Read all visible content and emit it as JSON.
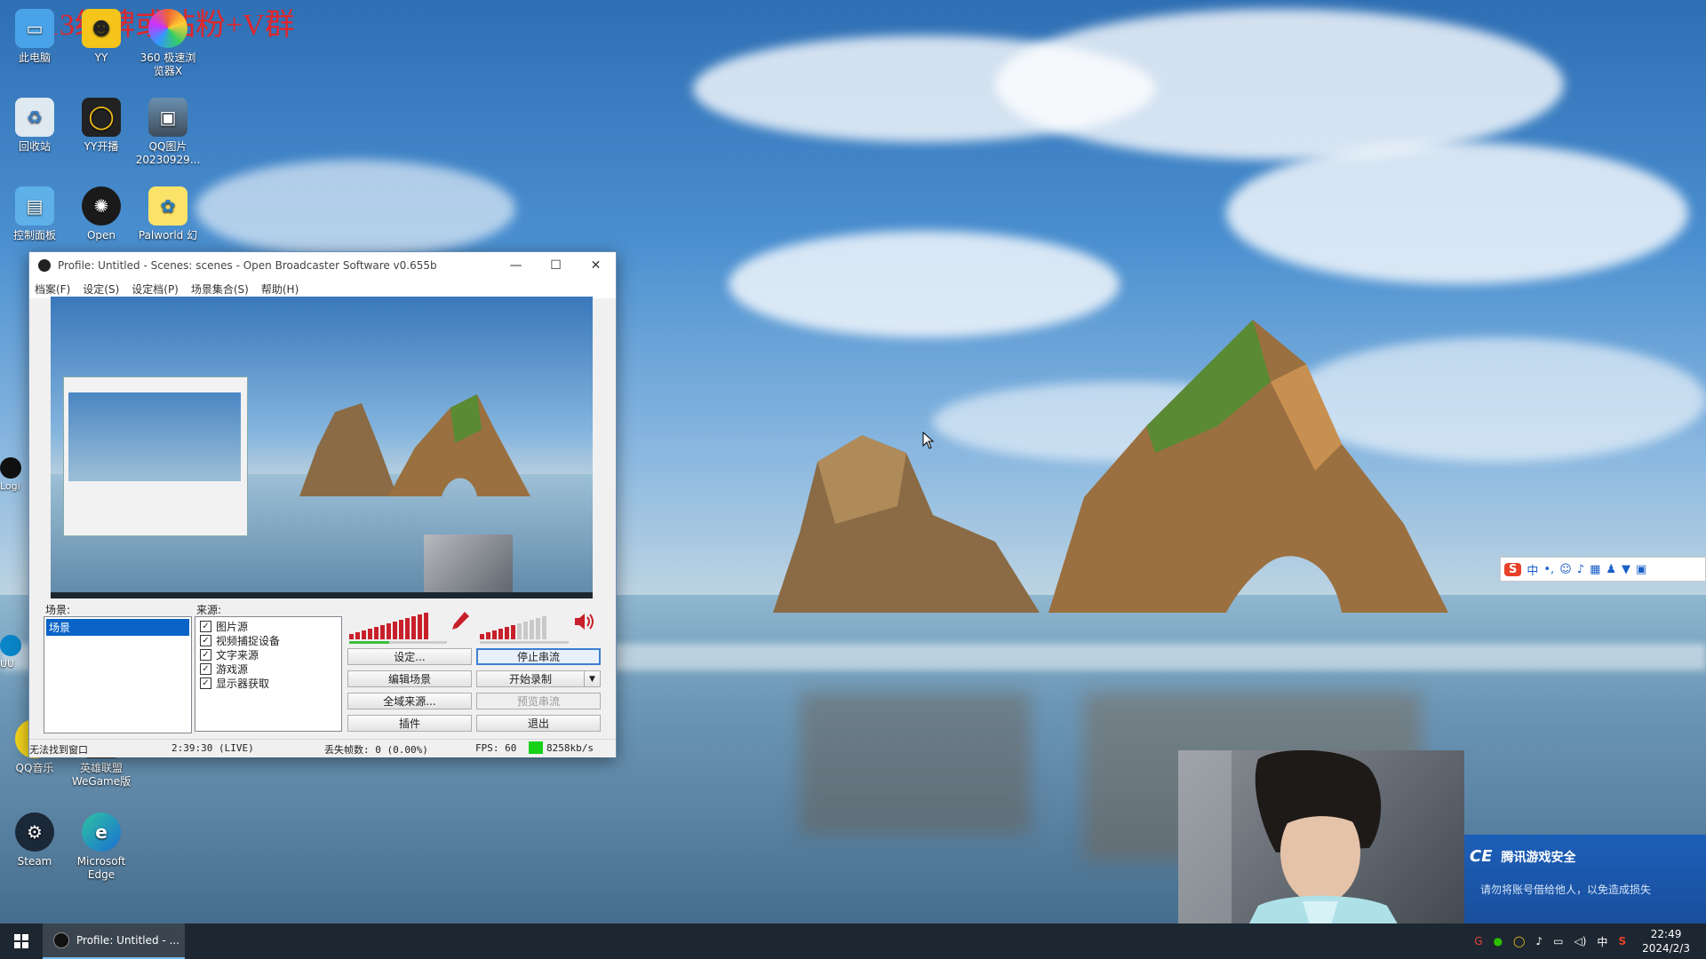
{
  "banner": "13级牌或钻粉+V群",
  "desktop_icons": [
    {
      "label": "此电脑",
      "icon": "computer-icon"
    },
    {
      "label": "YY",
      "icon": "yy-icon"
    },
    {
      "label": "360 极速浏览器X",
      "icon": "browser-360-icon"
    },
    {
      "label": "回收站",
      "icon": "recycle-bin-icon"
    },
    {
      "label": "YY开播",
      "icon": "yy-live-icon"
    },
    {
      "label": "QQ图片20230929...",
      "icon": "photo-icon"
    },
    {
      "label": "控制面板",
      "icon": "control-panel-icon"
    },
    {
      "label": "Open",
      "icon": "obs-icon"
    },
    {
      "label": "Palworld 幻",
      "icon": "palworld-icon"
    },
    {
      "label": "QQ音乐",
      "icon": "qq-music-icon"
    },
    {
      "label": "英雄联盟WeGame版",
      "icon": "wegame-icon"
    },
    {
      "label": "Steam",
      "icon": "steam-icon"
    },
    {
      "label": "Microsoft Edge",
      "icon": "edge-icon"
    }
  ],
  "edge_labels": [
    "Logi",
    "UU"
  ],
  "obs": {
    "title": "Profile: Untitled - Scenes: scenes - Open Broadcaster Software v0.655b",
    "window_controls": {
      "minimize": "—",
      "maximize": "☐",
      "close": "✕"
    },
    "menu": [
      "档案(F)",
      "设定(S)",
      "设定档(P)",
      "场景集合(S)",
      "帮助(H)"
    ],
    "scenes_label": "场景:",
    "scenes": [
      "场景"
    ],
    "sources_label": "来源:",
    "sources": [
      "图片源",
      "视频捕捉设备",
      "文字来源",
      "游戏源",
      "显示器获取"
    ],
    "buttons": {
      "settings": "设定...",
      "stop_stream": "停止串流",
      "edit_scene": "编辑场景",
      "start_record": "开始录制",
      "global_sources": "全域来源...",
      "preview_stream": "预览串流",
      "plugins": "插件",
      "exit": "退出"
    },
    "status": {
      "window": "无法找到窗口",
      "time": "2:39:30 (LIVE)",
      "dropped": "丢失帧数: 0 (0.00%)",
      "fps": "FPS: 60",
      "bitrate": "8258kb/s"
    }
  },
  "toast": {
    "title": "腾讯游戏安全",
    "message": "请勿将账号借给他人，以免造成损失"
  },
  "ime": {
    "mode": "中"
  },
  "taskbar": {
    "task_label": "Profile: Untitled - ...",
    "tray_ime": "中",
    "time": "22:49",
    "date": "2024/2/3"
  },
  "colors": {
    "banner": "#e0262b",
    "accent": "#3c7fd1",
    "meter_red": "#c8202a",
    "bitrate_ok": "#18d018",
    "toast_bg": "#1c5fb8"
  }
}
